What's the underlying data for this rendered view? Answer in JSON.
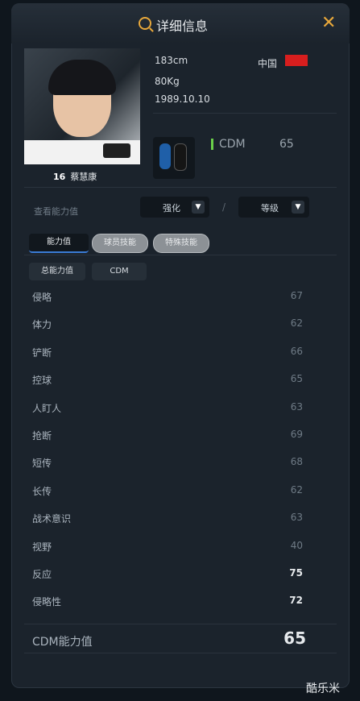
{
  "header": {
    "title": "详细信息"
  },
  "player": {
    "jersey_number": "16",
    "name": "蔡慧康",
    "height": "183cm",
    "weight": "80Kg",
    "birthdate": "1989.10.10",
    "nation": "中国",
    "position": "CDM",
    "position_rating": "65"
  },
  "filters": {
    "label": "查看能力值",
    "enhance": "强化",
    "level": "等级",
    "separator": "/"
  },
  "tabs": [
    "能力值",
    "球员技能",
    "特殊技能"
  ],
  "chips": [
    "总能力值",
    "CDM"
  ],
  "stats": [
    {
      "name": "侵略",
      "value": "67"
    },
    {
      "name": "体力",
      "value": "62"
    },
    {
      "name": "铲断",
      "value": "66"
    },
    {
      "name": "控球",
      "value": "65"
    },
    {
      "name": "人盯人",
      "value": "63"
    },
    {
      "name": "抢断",
      "value": "69"
    },
    {
      "name": "短传",
      "value": "68"
    },
    {
      "name": "长传",
      "value": "62"
    },
    {
      "name": "战术意识",
      "value": "63"
    },
    {
      "name": "视野",
      "value": "40"
    },
    {
      "name": "反应",
      "value": "75"
    },
    {
      "name": "侵略性",
      "value": "72"
    }
  ],
  "summary": {
    "label": "CDM能力值",
    "value": "65"
  },
  "watermark": "酷乐米",
  "colors": {
    "accent": "#e8a83b",
    "flag": "#d81e1e",
    "position_indicator": "#6bd04a"
  },
  "icons": {
    "search": "search-icon",
    "close": "close-icon",
    "dropdown": "chevron-down-icon"
  }
}
